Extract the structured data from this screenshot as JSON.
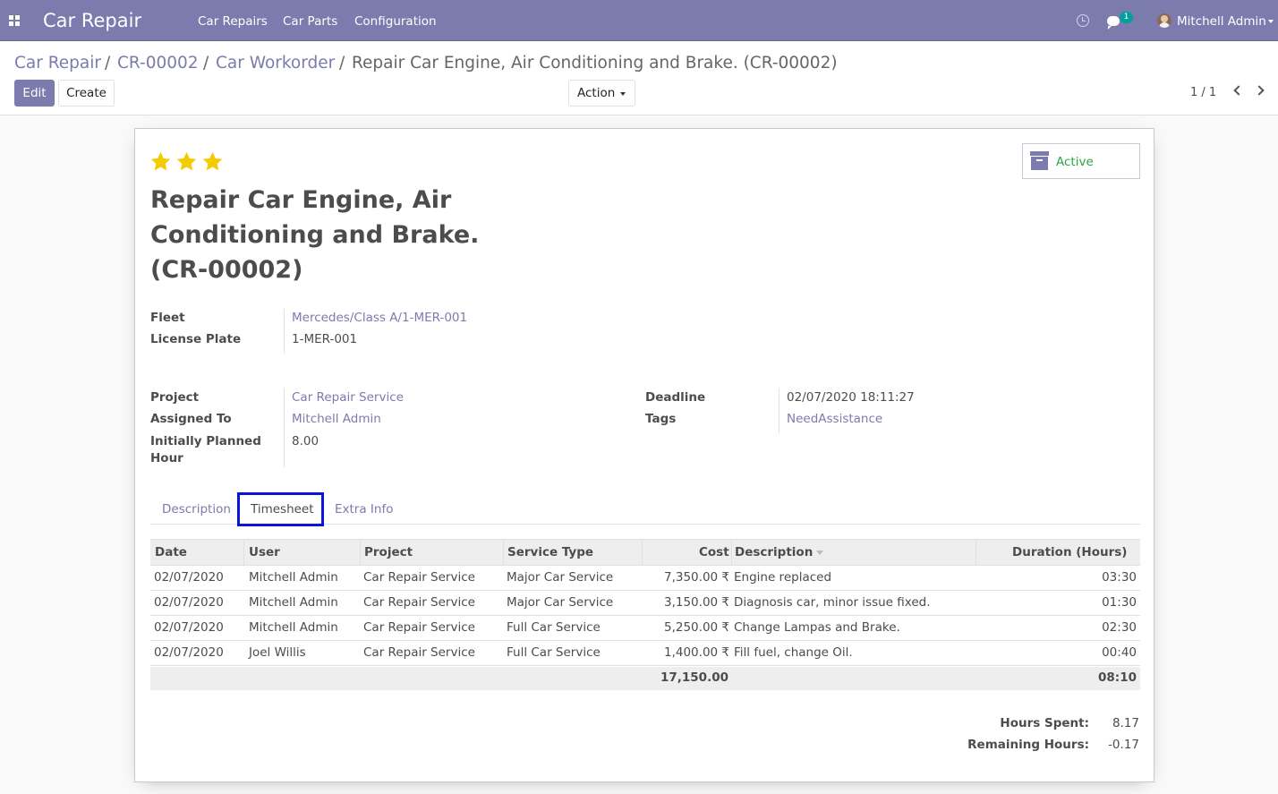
{
  "navbar": {
    "app_name": "Car Repair",
    "menus": [
      "Car Repairs",
      "Car Parts",
      "Configuration"
    ],
    "chat_count": "1",
    "user": "Mitchell Admin",
    "icons": [
      "apps-grid-icon",
      "clock-icon",
      "chat-icon",
      "avatar"
    ],
    "color": "#7c7bad"
  },
  "breadcrumb": {
    "items": [
      "Car Repair",
      "CR-00002",
      "Car Workorder"
    ],
    "separator": "/",
    "current": "Repair Car Engine, Air Conditioning and Brake. (CR-00002)"
  },
  "buttons": {
    "edit": "Edit",
    "create": "Create",
    "action": "Action"
  },
  "pager": {
    "value": "1 / 1"
  },
  "record": {
    "priority_stars": 3,
    "title": "Repair Car Engine, Air Conditioning and Brake. (CR-00002)",
    "status_button": "Active",
    "fields": {
      "fleet_label": "Fleet",
      "fleet": "Mercedes/Class A/1-MER-001",
      "license_plate_label": "License Plate",
      "license_plate": "1-MER-001",
      "project_label": "Project",
      "project": "Car Repair Service",
      "assigned_to_label": "Assigned To",
      "assigned_to": "Mitchell Admin",
      "planned_hours_label": "Initially Planned Hour",
      "planned_hours": "8.00",
      "deadline_label": "Deadline",
      "deadline": "02/07/2020 18:11:27",
      "tags_label": "Tags",
      "tags": "NeedAssistance"
    }
  },
  "tabs": [
    "Description",
    "Timesheet",
    "Extra Info"
  ],
  "active_tab": "Timesheet",
  "timesheet": {
    "columns": [
      "Date",
      "User",
      "Project",
      "Service Type",
      "Cost",
      "Description",
      "Duration (Hours)"
    ],
    "rows": [
      {
        "date": "02/07/2020",
        "user": "Mitchell Admin",
        "project": "Car Repair Service",
        "service_type": "Major Car Service",
        "cost": "7,350.00 ₹",
        "description": "Engine replaced",
        "duration": "03:30"
      },
      {
        "date": "02/07/2020",
        "user": "Mitchell Admin",
        "project": "Car Repair Service",
        "service_type": "Major Car Service",
        "cost": "3,150.00 ₹",
        "description": "Diagnosis car, minor issue fixed.",
        "duration": "01:30"
      },
      {
        "date": "02/07/2020",
        "user": "Mitchell Admin",
        "project": "Car Repair Service",
        "service_type": "Full Car Service",
        "cost": "5,250.00 ₹",
        "description": "Change Lampas and Brake.",
        "duration": "02:30"
      },
      {
        "date": "02/07/2020",
        "user": "Joel Willis",
        "project": "Car Repair Service",
        "service_type": "Full Car Service",
        "cost": "1,400.00 ₹",
        "description": "Fill fuel, change Oil.",
        "duration": "00:40"
      }
    ],
    "total_cost": "17,150.00",
    "total_duration": "08:10"
  },
  "summary": {
    "hours_spent_label": "Hours Spent:",
    "hours_spent": "8.17",
    "remaining_hours_label": "Remaining Hours:",
    "remaining_hours": "-0.17"
  }
}
